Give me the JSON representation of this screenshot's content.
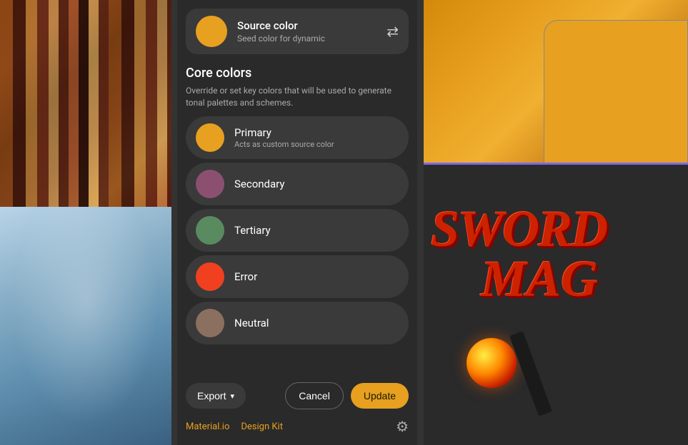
{
  "dialog": {
    "source_color": {
      "title": "Source color",
      "subtitle": "Seed color for dynamic",
      "color": "#E8A020",
      "shuffle_icon": "⇄"
    },
    "core_colors": {
      "title": "Core colors",
      "description": "Override or set key colors that will be used to generate tonal palettes and schemes.",
      "items": [
        {
          "name": "Primary",
          "subtitle": "Acts as custom source color",
          "color": "#E8A020"
        },
        {
          "name": "Secondary",
          "subtitle": "",
          "color": "#8B5070"
        },
        {
          "name": "Tertiary",
          "subtitle": "",
          "color": "#5A8A60"
        },
        {
          "name": "Error",
          "subtitle": "",
          "color": "#F04020"
        },
        {
          "name": "Neutral",
          "subtitle": "",
          "color": "#8B7060"
        }
      ]
    },
    "footer": {
      "export_label": "Export",
      "cancel_label": "Cancel",
      "update_label": "Update",
      "material_link": "Material.io",
      "design_kit_link": "Design Kit",
      "settings_icon": "⚙",
      "chevron_icon": "▾"
    }
  }
}
